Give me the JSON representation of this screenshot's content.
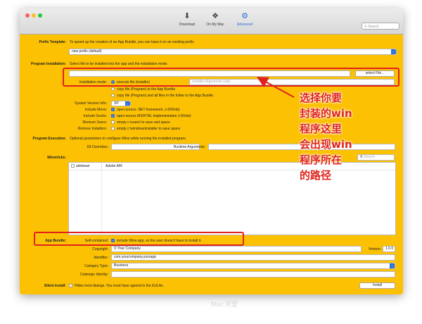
{
  "toolbar": {
    "items": [
      {
        "label": "Download",
        "icon": "download-icon"
      },
      {
        "label": "On My Mac",
        "icon": "puzzle-icon"
      },
      {
        "label": "Advanced",
        "icon": "gear-icon"
      }
    ],
    "search_placeholder": "Search"
  },
  "prefix": {
    "label": "Prefix Template:",
    "description": "To speed up the creation of an App Bundle, you can base it on an existing prefix.",
    "selected": "new prefix (default)"
  },
  "program_installation": {
    "label": "Program Installation:",
    "description": "Select file to be installed into the app and the installation mode.",
    "file_value": "",
    "select_button": "select File...",
    "mode_label": "Installation mode:",
    "modes": [
      "execute file (installer)",
      "copy file (Program) to the App Bundle",
      "copy file (Program) and all files in the folder to the App Bundle."
    ],
    "args_placeholder": "Installer Arguments (opt)"
  },
  "options": {
    "version_label": "System Version Info:",
    "version_value": "XP",
    "mono_label": "Include Mono:",
    "mono_text": "open-source .NET framework. (+200mb)",
    "gecko_label": "Include Gecko:",
    "gecko_text": "open-source MSHTML implementation (+50mb)",
    "users_label": "Remove Users:",
    "users_text": "empty c:\\users\\ to save and space",
    "installers_label": "Remove Installers:",
    "installers_text": "empty c:\\windows\\installer to save space"
  },
  "program_execution": {
    "label": "Program Execution:",
    "description": "Optional parameters to configure Wine while running the installed program.",
    "dll_label": "Dll Overrides:",
    "runtime_label": "Runtime Arguments:"
  },
  "winetricks": {
    "label": "Winetricks:",
    "search_placeholder": "Search",
    "rows": [
      {
        "name": "adobeair",
        "desc": "Adobe AIR"
      }
    ]
  },
  "app_bundle": {
    "label": "App Bundle:",
    "self_label": "Self-contained:",
    "self_text": "include Wine.app, so the user doesn't have to install it.",
    "copyright_label": "Copyright:",
    "copyright_value": "© Your Company",
    "version_label": "Version:",
    "version_value": "1.0.0",
    "identifier_label": "Identifier:",
    "identifier_value": "com.yourcompany.yourapp",
    "category_label": "Category Type:",
    "category_value": "Business",
    "codesign_label": "Codesign Identity:"
  },
  "silent": {
    "label": "Silent install:",
    "text": "Hides most dialogs. You must have agreed to the EULAs.",
    "install_button": "Install"
  },
  "annotation": {
    "lines": [
      "选择你要",
      "封装的win",
      "程序这里",
      "会出现win",
      "程序所在",
      "的路径"
    ],
    "color": "#e0221c"
  },
  "watermark": {
    "text": "Mac 天堂"
  }
}
